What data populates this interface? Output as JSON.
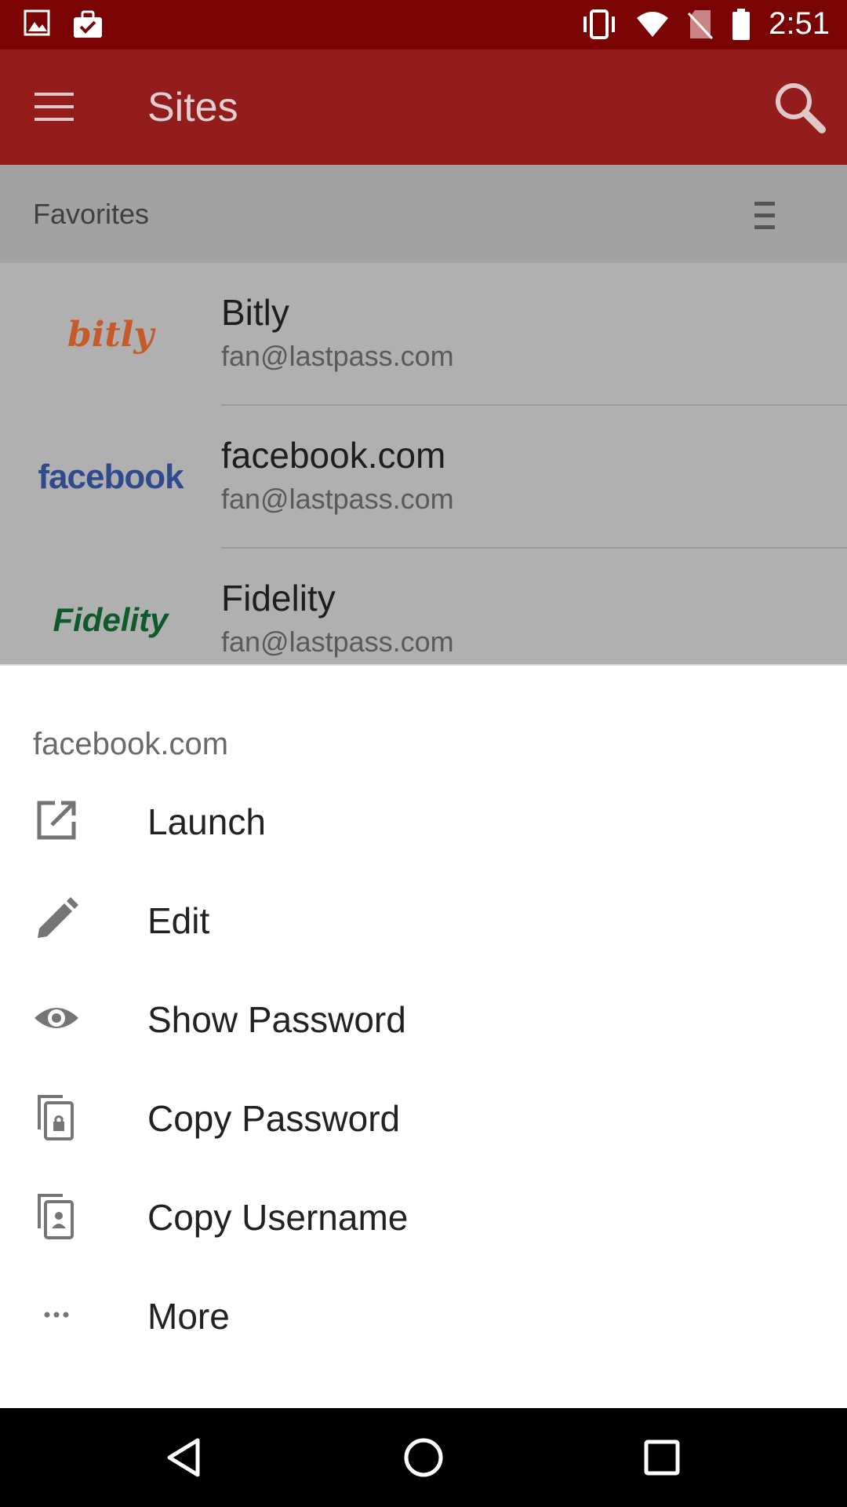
{
  "status_bar": {
    "time": "2:51",
    "icons": [
      "image-icon",
      "briefcase-check-icon",
      "vibrate-icon",
      "wifi-icon",
      "no-sim-icon",
      "battery-icon"
    ]
  },
  "app_bar": {
    "title": "Sites",
    "background": "#931c1c",
    "status_background": "#7a0404"
  },
  "section": {
    "title": "Favorites"
  },
  "sites": [
    {
      "logo_text": "bitly",
      "name": "Bitly",
      "username": "fan@lastpass.com",
      "logo_color": "#c65a2b"
    },
    {
      "logo_text": "facebook",
      "name": "facebook.com",
      "username": "fan@lastpass.com",
      "logo_color": "#2f4b8e"
    },
    {
      "logo_text": "Fidelity",
      "name": "Fidelity",
      "username": "fan@lastpass.com",
      "logo_color": "#0f5a2a"
    }
  ],
  "sheet": {
    "title": "facebook.com",
    "actions": [
      {
        "label": "Launch",
        "icon": "launch-icon"
      },
      {
        "label": "Edit",
        "icon": "pencil-icon"
      },
      {
        "label": "Show Password",
        "icon": "eye-icon"
      },
      {
        "label": "Copy Password",
        "icon": "copy-password-icon"
      },
      {
        "label": "Copy Username",
        "icon": "copy-username-icon"
      },
      {
        "label": "More",
        "icon": "more-dots-icon"
      }
    ]
  },
  "nav_bar": {
    "buttons": [
      "back-icon",
      "home-icon",
      "recents-icon"
    ]
  }
}
